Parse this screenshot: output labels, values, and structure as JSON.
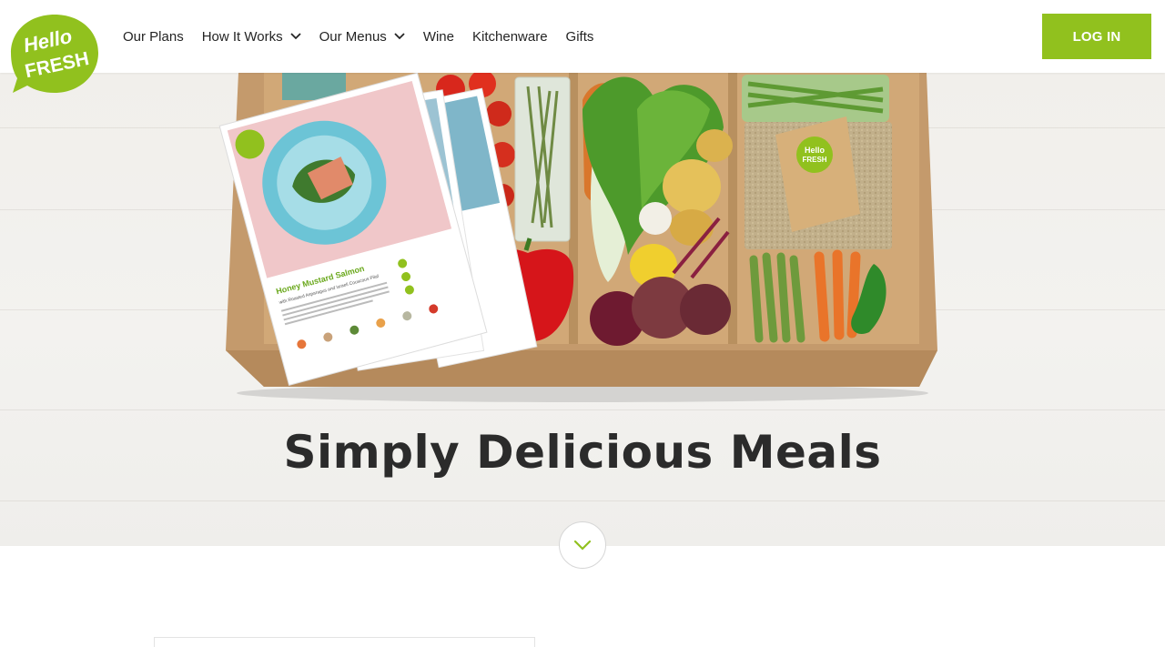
{
  "brand": {
    "logo_line1": "Hello",
    "logo_line2": "FRESH",
    "logo_color": "#91c11e"
  },
  "nav": {
    "items": [
      {
        "label": "Our Plans",
        "has_dropdown": false
      },
      {
        "label": "How It Works",
        "has_dropdown": true
      },
      {
        "label": "Our Menus",
        "has_dropdown": true
      },
      {
        "label": "Wine",
        "has_dropdown": false
      },
      {
        "label": "Kitchenware",
        "has_dropdown": false
      },
      {
        "label": "Gifts",
        "has_dropdown": false
      }
    ],
    "login_label": "LOG IN"
  },
  "hero": {
    "title": "Simply Delicious Meals",
    "recipe_card_title": "Honey Mustard Salmon",
    "recipe_card_subtitle": "with Roasted Asparagus and Israeli Couscous Pilaf"
  },
  "colors": {
    "accent": "#91c11e",
    "text": "#242424"
  },
  "icons": {
    "scroll": "chevron-down-icon",
    "dropdown": "chevron-down-icon"
  }
}
